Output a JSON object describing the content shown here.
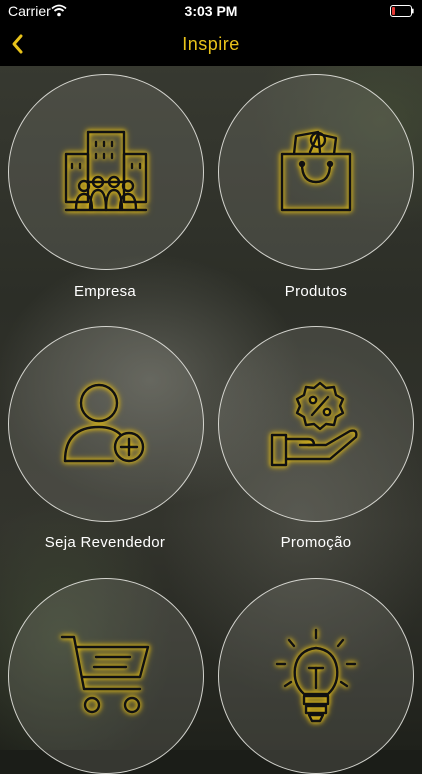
{
  "status_bar": {
    "carrier": "Carrier",
    "time": "3:03 PM",
    "battery_color": "#e53935"
  },
  "nav": {
    "title": "Inspire",
    "accent_color": "#e8c21a",
    "back_icon": "chevron-left-icon"
  },
  "menu": [
    {
      "label": "Empresa",
      "icon": "building-people-icon"
    },
    {
      "label": "Produtos",
      "icon": "shopping-bag-icon"
    },
    {
      "label": "Seja Revendedor",
      "icon": "add-user-icon"
    },
    {
      "label": "Promoção",
      "icon": "percent-badge-hand-icon"
    },
    {
      "label": "",
      "icon": "shopping-cart-icon"
    },
    {
      "label": "",
      "icon": "lightbulb-icon"
    }
  ]
}
